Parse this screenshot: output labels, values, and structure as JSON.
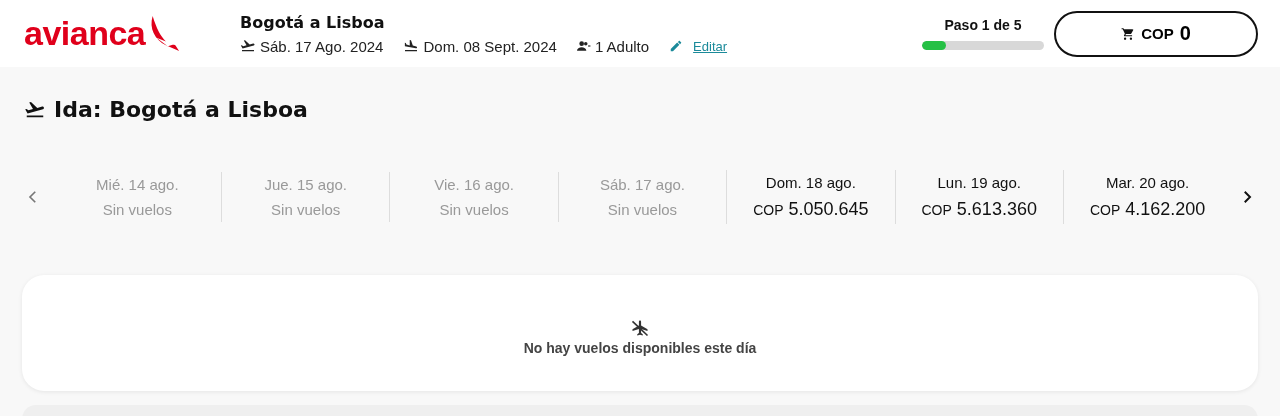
{
  "header": {
    "logo": "avianca",
    "route": "Bogotá a Lisboa",
    "departure": "Sáb. 17 Ago. 2024",
    "return": "Dom. 08 Sept. 2024",
    "passengers": "1 Adulto",
    "edit_link": "Editar",
    "step": {
      "label": "Paso 1 de 5",
      "level": 0.2
    },
    "cart": {
      "currency": "COP",
      "amount": "0"
    }
  },
  "section_title": "Ida: Bogotá a Lisboa",
  "dates": [
    {
      "kind": "unavailable",
      "day": "Mié. 14 ago.",
      "status": "Sin vuelos"
    },
    {
      "kind": "unavailable",
      "day": "Jue. 15 ago.",
      "status": "Sin vuelos"
    },
    {
      "kind": "unavailable",
      "day": "Vie. 16 ago.",
      "status": "Sin vuelos"
    },
    {
      "kind": "unavailable",
      "day": "Sáb. 17 ago.",
      "status": "Sin vuelos"
    },
    {
      "kind": "priced",
      "day": "Dom. 18 ago.",
      "currency": "COP",
      "price": "5.050.645"
    },
    {
      "kind": "priced",
      "day": "Lun. 19 ago.",
      "currency": "COP",
      "price": "5.613.360"
    },
    {
      "kind": "priced",
      "day": "Mar. 20 ago.",
      "currency": "COP",
      "price": "4.162.200"
    }
  ],
  "empty_message": "No hay vuelos disponibles este día"
}
